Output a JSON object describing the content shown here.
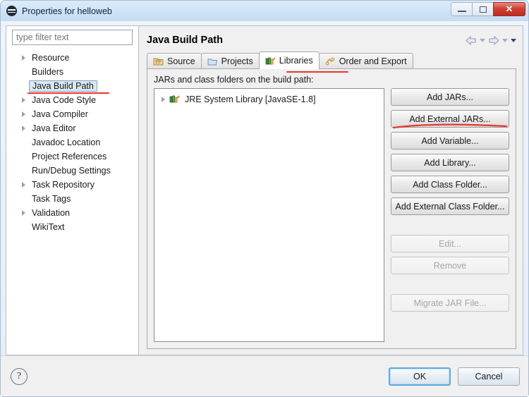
{
  "window": {
    "title": "Properties for helloweb",
    "icon": "eclipse-icon",
    "minimize_label": "Minimize",
    "maximize_label": "Restore",
    "close_label": "Close"
  },
  "sidebar": {
    "filter_placeholder": "type filter text",
    "filter_value": "",
    "items": [
      {
        "label": "Resource",
        "expandable": true,
        "selected": false
      },
      {
        "label": "Builders",
        "expandable": false,
        "selected": false
      },
      {
        "label": "Java Build Path",
        "expandable": false,
        "selected": true
      },
      {
        "label": "Java Code Style",
        "expandable": true,
        "selected": false
      },
      {
        "label": "Java Compiler",
        "expandable": true,
        "selected": false
      },
      {
        "label": "Java Editor",
        "expandable": true,
        "selected": false
      },
      {
        "label": "Javadoc Location",
        "expandable": false,
        "selected": false
      },
      {
        "label": "Project References",
        "expandable": false,
        "selected": false
      },
      {
        "label": "Run/Debug Settings",
        "expandable": false,
        "selected": false
      },
      {
        "label": "Task Repository",
        "expandable": true,
        "selected": false
      },
      {
        "label": "Task Tags",
        "expandable": false,
        "selected": false
      },
      {
        "label": "Validation",
        "expandable": true,
        "selected": false
      },
      {
        "label": "WikiText",
        "expandable": false,
        "selected": false
      }
    ]
  },
  "main": {
    "page_title": "Java Build Path",
    "nav": {
      "back_icon": "back-arrow-icon",
      "back_menu_icon": "chevron-down-icon",
      "forward_icon": "forward-arrow-icon",
      "forward_menu_icon": "chevron-down-icon",
      "view_menu_icon": "chevron-down-icon"
    },
    "tabs": [
      {
        "label": "Source",
        "icon": "source-folder-icon",
        "active": false
      },
      {
        "label": "Projects",
        "icon": "projects-folder-icon",
        "active": false
      },
      {
        "label": "Libraries",
        "icon": "libraries-books-icon",
        "active": true
      },
      {
        "label": "Order and Export",
        "icon": "order-export-icon",
        "active": false
      }
    ],
    "content_label": "JARs and class folders on the build path:",
    "list_items": [
      {
        "label": "JRE System Library [JavaSE-1.8]",
        "icon": "library-icon",
        "expandable": true
      }
    ],
    "buttons": [
      {
        "label": "Add JARs...",
        "enabled": true
      },
      {
        "label": "Add External JARs...",
        "enabled": true
      },
      {
        "label": "Add Variable...",
        "enabled": true
      },
      {
        "label": "Add Library...",
        "enabled": true
      },
      {
        "label": "Add Class Folder...",
        "enabled": true
      },
      {
        "label": "Add External Class Folder...",
        "enabled": true
      },
      {
        "label": "Edit...",
        "enabled": false
      },
      {
        "label": "Remove",
        "enabled": false
      },
      {
        "label": "Migrate JAR File...",
        "enabled": false
      }
    ]
  },
  "footer": {
    "help_label": "?",
    "ok_label": "OK",
    "cancel_label": "Cancel"
  },
  "annotations": {
    "color": "#e8362c",
    "underline_sidebar_target": "Java Build Path",
    "underline_tab_target": "Libraries",
    "underline_button_target": "Add External JARs..."
  }
}
